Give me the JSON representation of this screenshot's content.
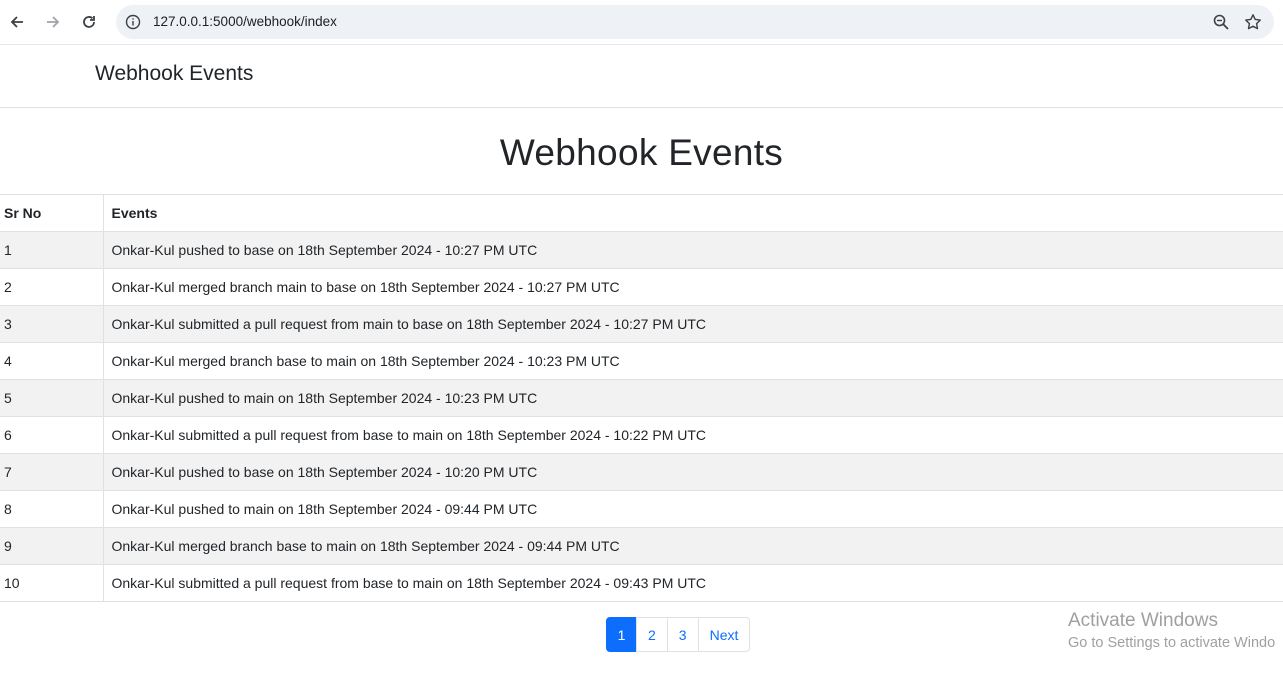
{
  "browser": {
    "url": "127.0.0.1:5000/webhook/index",
    "icons": [
      "back-icon",
      "forward-icon",
      "reload-icon",
      "info-icon",
      "zoom-icon",
      "star-icon"
    ]
  },
  "navbar": {
    "brand": "Webhook Events"
  },
  "main": {
    "title": "Webhook Events",
    "table": {
      "headers": [
        "Sr No",
        "Events"
      ],
      "rows": [
        {
          "sr": "1",
          "event": "Onkar-Kul pushed to base on 18th September 2024 - 10:27 PM UTC"
        },
        {
          "sr": "2",
          "event": "Onkar-Kul merged branch main to base on 18th September 2024 - 10:27 PM UTC"
        },
        {
          "sr": "3",
          "event": "Onkar-Kul submitted a pull request from main to base on 18th September 2024 - 10:27 PM UTC"
        },
        {
          "sr": "4",
          "event": "Onkar-Kul merged branch base to main on 18th September 2024 - 10:23 PM UTC"
        },
        {
          "sr": "5",
          "event": "Onkar-Kul pushed to main on 18th September 2024 - 10:23 PM UTC"
        },
        {
          "sr": "6",
          "event": "Onkar-Kul submitted a pull request from base to main on 18th September 2024 - 10:22 PM UTC"
        },
        {
          "sr": "7",
          "event": "Onkar-Kul pushed to base on 18th September 2024 - 10:20 PM UTC"
        },
        {
          "sr": "8",
          "event": "Onkar-Kul pushed to main on 18th September 2024 - 09:44 PM UTC"
        },
        {
          "sr": "9",
          "event": "Onkar-Kul merged branch base to main on 18th September 2024 - 09:44 PM UTC"
        },
        {
          "sr": "10",
          "event": "Onkar-Kul submitted a pull request from base to main on 18th September 2024 - 09:43 PM UTC"
        }
      ]
    },
    "pagination": {
      "pages": [
        "1",
        "2",
        "3"
      ],
      "active": "1",
      "next_label": "Next"
    }
  },
  "watermark": {
    "line1": "Activate Windows",
    "line2": "Go to Settings to activate Windo"
  },
  "colors": {
    "accent": "#0d6efd",
    "stripe": "#f2f2f2",
    "border": "#dee2e6"
  }
}
